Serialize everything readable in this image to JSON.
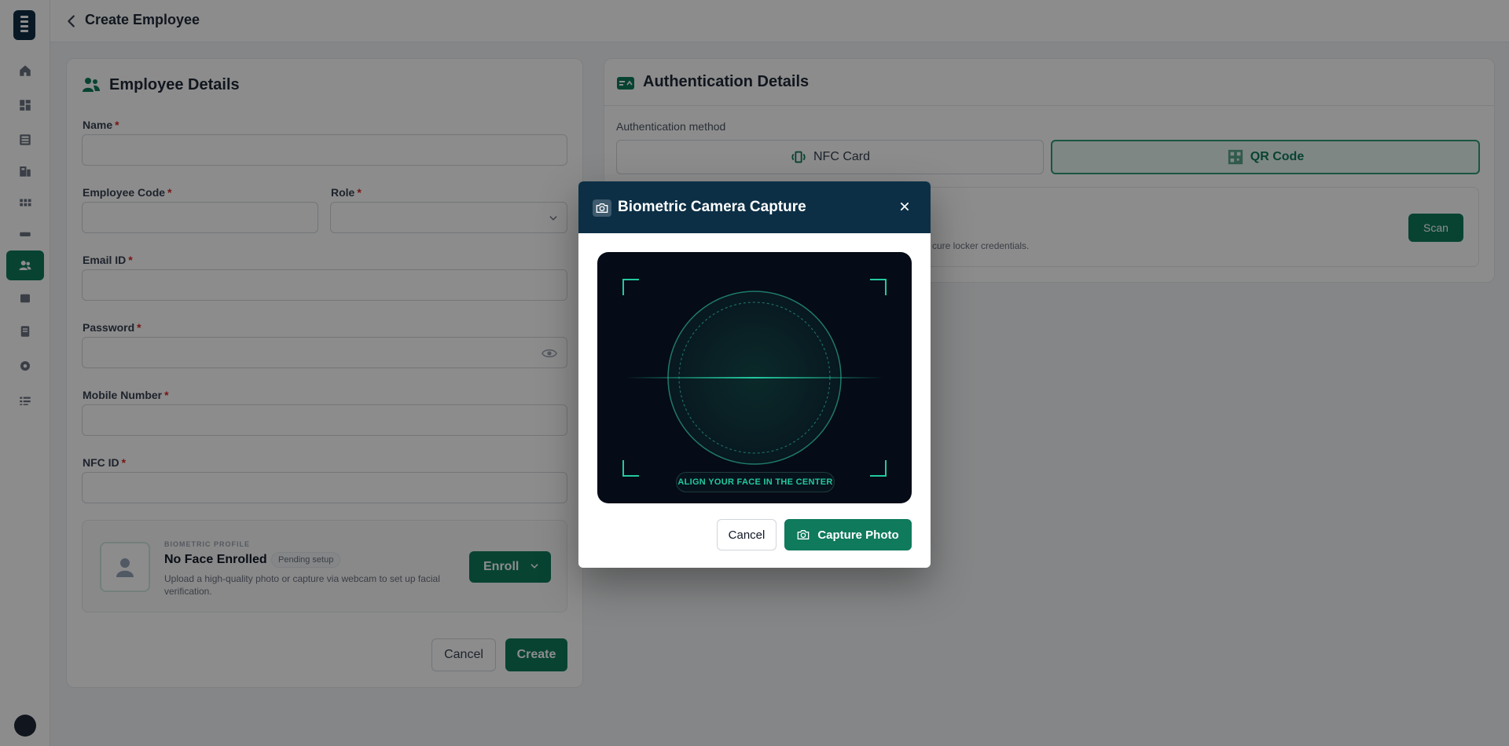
{
  "header": {
    "title": "Create Employee"
  },
  "sidebar": {
    "items": [
      {
        "icon": "home-icon"
      },
      {
        "icon": "dashboard-icon"
      },
      {
        "icon": "lockers-icon"
      },
      {
        "icon": "building-icon"
      },
      {
        "icon": "grid-icon"
      },
      {
        "icon": "card-icon"
      },
      {
        "icon": "employees-icon",
        "active": true
      },
      {
        "icon": "box-icon"
      },
      {
        "icon": "report-icon"
      },
      {
        "icon": "settings-icon"
      },
      {
        "icon": "list-icon"
      }
    ]
  },
  "employee_details": {
    "title": "Employee Details",
    "fields": {
      "name": {
        "label": "Name",
        "required": "*",
        "value": ""
      },
      "employee_code": {
        "label": "Employee Code",
        "required": "*",
        "value": ""
      },
      "role": {
        "label": "Role",
        "required": "*",
        "value": ""
      },
      "email": {
        "label": "Email ID",
        "required": "*",
        "value": ""
      },
      "password": {
        "label": "Password",
        "required": "*",
        "value": ""
      },
      "mobile": {
        "label": "Mobile Number",
        "required": "*",
        "value": ""
      },
      "nfc_id": {
        "label": "NFC ID",
        "required": "*",
        "value": ""
      }
    },
    "biometric": {
      "kicker": "BIOMETRIC PROFILE",
      "title": "No Face Enrolled",
      "badge": "Pending setup",
      "description": "Upload a high-quality photo or capture via webcam to set up facial verification.",
      "enroll_label": "Enroll"
    },
    "cancel_label": "Cancel",
    "create_label": "Create"
  },
  "authentication": {
    "title": "Authentication Details",
    "method_label": "Authentication method",
    "options": [
      {
        "label": "NFC Card",
        "selected": false
      },
      {
        "label": "QR Code",
        "selected": true
      }
    ],
    "scan_description": "cure locker credentials.",
    "scan_label": "Scan"
  },
  "modal": {
    "title": "Biometric Camera Capture",
    "hint": "ALIGN YOUR FACE IN THE CENTER",
    "cancel_label": "Cancel",
    "capture_label": "Capture Photo"
  },
  "colors": {
    "primary": "#0f7a5c",
    "navy": "#0c2f45",
    "accent": "#22c9a0"
  }
}
